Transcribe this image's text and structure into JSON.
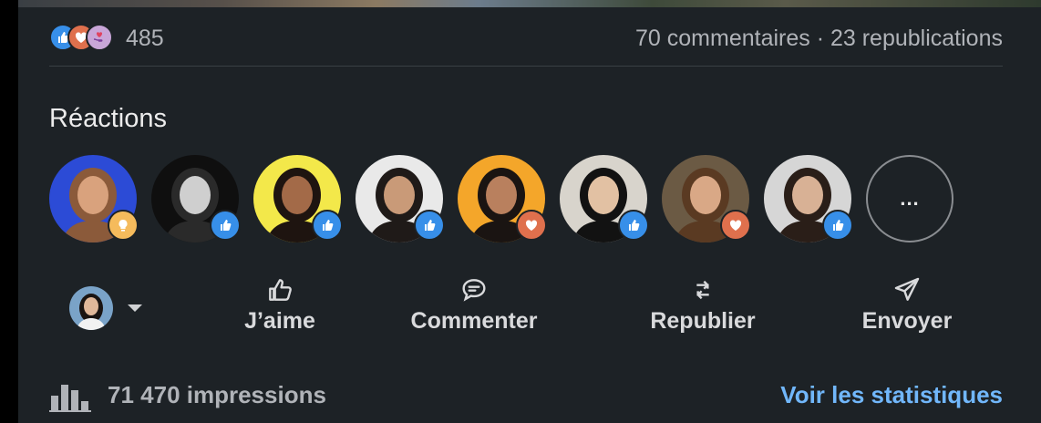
{
  "stats": {
    "reaction_count": "485",
    "comments_reposts": "70 commentaires · 23 republications",
    "reaction_types": [
      "like-icon",
      "love-icon",
      "support-icon"
    ]
  },
  "reactions": {
    "title": "Réactions",
    "people": [
      {
        "reaction": "insight",
        "bg": "#2c4bd6",
        "skin": "#d9a27d",
        "hair": "#8b5a3a"
      },
      {
        "reaction": "like",
        "bg": "#0f0f0f",
        "skin": "#cfcfcf",
        "hair": "#2a2a2a"
      },
      {
        "reaction": "like",
        "bg": "#f3e84a",
        "skin": "#a36a48",
        "hair": "#1e1410"
      },
      {
        "reaction": "like",
        "bg": "#e9e9e9",
        "skin": "#c99a78",
        "hair": "#1f1a18"
      },
      {
        "reaction": "love",
        "bg": "#f4a62a",
        "skin": "#b9805e",
        "hair": "#1a1412"
      },
      {
        "reaction": "like",
        "bg": "#d8d4cc",
        "skin": "#e2c1a3",
        "hair": "#121212"
      },
      {
        "reaction": "love",
        "bg": "#6b5a44",
        "skin": "#d9a886",
        "hair": "#5a3a22"
      },
      {
        "reaction": "like",
        "bg": "#d6d6d6",
        "skin": "#d8b195",
        "hair": "#2a1e18"
      }
    ],
    "more_label": "..."
  },
  "actions": {
    "like": "J’aime",
    "comment": "Commenter",
    "repost": "Republier",
    "send": "Envoyer"
  },
  "footer": {
    "impressions": "71 470 impressions",
    "stats_link": "Voir les statistiques"
  },
  "colors": {
    "background": "#1d2226",
    "link": "#71b7fb",
    "like": "#378fe9",
    "love": "#df704d",
    "insight": "#f5bb5c"
  }
}
